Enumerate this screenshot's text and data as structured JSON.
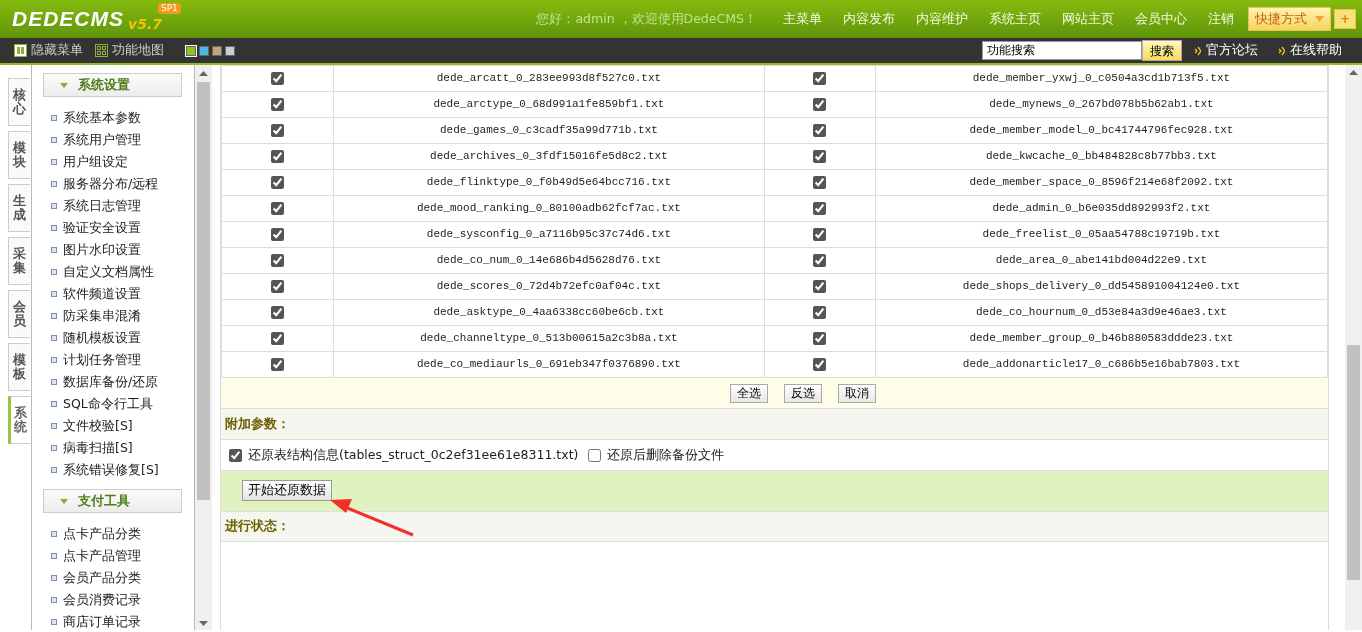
{
  "header": {
    "logo": "DEDECMS",
    "edition": "SP1",
    "version": "v5.7",
    "greeting": "您好：admin ，欢迎使用DedeCMS！",
    "nav": [
      "主菜单",
      "内容发布",
      "内容维护",
      "系统主页",
      "网站主页",
      "会员中心",
      "注销"
    ],
    "shortcut": "快捷方式",
    "add": "+"
  },
  "toolbar": {
    "tools": [
      {
        "label": "隐藏菜单",
        "kind": "hide"
      },
      {
        "label": "功能地图",
        "kind": "map"
      }
    ],
    "skins": [
      {
        "color": "#8dc21f",
        "selected": true
      },
      {
        "color": "#4fb4e6",
        "selected": false
      },
      {
        "color": "#c2a57f",
        "selected": false
      },
      {
        "color": "#c9ccd1",
        "selected": false
      }
    ],
    "search": {
      "value": "功能搜索",
      "button": "搜索"
    },
    "links": [
      "官方论坛",
      "在线帮助"
    ]
  },
  "side_tabs": [
    {
      "label": "核心",
      "selected": false
    },
    {
      "label": "模块",
      "selected": false
    },
    {
      "label": "生成",
      "selected": false
    },
    {
      "label": "采集",
      "selected": false
    },
    {
      "label": "会员",
      "selected": false
    },
    {
      "label": "模板",
      "selected": false
    },
    {
      "label": "系统",
      "selected": true
    }
  ],
  "sidebar": {
    "groups": [
      {
        "title": "系统设置",
        "expanded": true,
        "items": [
          "系统基本参数",
          "系统用户管理",
          "用户组设定",
          "服务器分布/远程",
          "系统日志管理",
          "验证安全设置",
          "图片水印设置",
          "自定义文档属性",
          "软件频道设置",
          "防采集串混淆",
          "随机模板设置",
          "计划任务管理",
          "数据库备份/还原",
          "SQL命令行工具",
          "文件校验[S]",
          "病毒扫描[S]",
          "系统错误修复[S]"
        ]
      },
      {
        "title": "支付工具",
        "expanded": true,
        "items": [
          "点卡产品分类",
          "点卡产品管理",
          "会员产品分类",
          "会员消费记录",
          "商店订单记录"
        ]
      }
    ]
  },
  "table": {
    "rows": [
      {
        "left": {
          "checked": true,
          "file": "dede_arcatt_0_283ee993d8f527c0.txt"
        },
        "right": {
          "checked": true,
          "file": "dede_member_yxwj_0_c0504a3cd1b713f5.txt"
        }
      },
      {
        "left": {
          "checked": true,
          "file": "dede_arctype_0_68d991a1fe859bf1.txt"
        },
        "right": {
          "checked": true,
          "file": "dede_mynews_0_267bd078b5b62ab1.txt"
        }
      },
      {
        "left": {
          "checked": true,
          "file": "dede_games_0_c3cadf35a99d771b.txt"
        },
        "right": {
          "checked": true,
          "file": "dede_member_model_0_bc41744796fec928.txt"
        }
      },
      {
        "left": {
          "checked": true,
          "file": "dede_archives_0_3fdf15016fe5d8c2.txt"
        },
        "right": {
          "checked": true,
          "file": "dede_kwcache_0_bb484828c8b77bb3.txt"
        }
      },
      {
        "left": {
          "checked": true,
          "file": "dede_flinktype_0_f0b49d5e64bcc716.txt"
        },
        "right": {
          "checked": true,
          "file": "dede_member_space_0_8596f214e68f2092.txt"
        }
      },
      {
        "left": {
          "checked": true,
          "file": "dede_mood_ranking_0_80100adb62fcf7ac.txt"
        },
        "right": {
          "checked": true,
          "file": "dede_admin_0_b6e035dd892993f2.txt"
        }
      },
      {
        "left": {
          "checked": true,
          "file": "dede_sysconfig_0_a7116b95c37c74d6.txt"
        },
        "right": {
          "checked": true,
          "file": "dede_freelist_0_05aa54788c19719b.txt"
        }
      },
      {
        "left": {
          "checked": true,
          "file": "dede_co_num_0_14e686b4d5628d76.txt"
        },
        "right": {
          "checked": true,
          "file": "dede_area_0_abe141bd004d22e9.txt"
        }
      },
      {
        "left": {
          "checked": true,
          "file": "dede_scores_0_72d4b72efc0af04c.txt"
        },
        "right": {
          "checked": true,
          "file": "dede_shops_delivery_0_dd545891004124e0.txt"
        }
      },
      {
        "left": {
          "checked": true,
          "file": "dede_asktype_0_4aa6338cc60be6cb.txt"
        },
        "right": {
          "checked": true,
          "file": "dede_co_hournum_0_d53e84a3d9e46ae3.txt"
        }
      },
      {
        "left": {
          "checked": true,
          "file": "dede_channeltype_0_513b00615a2c3b8a.txt"
        },
        "right": {
          "checked": true,
          "file": "dede_member_group_0_b46b880583ddde23.txt"
        }
      },
      {
        "left": {
          "checked": true,
          "file": "dede_co_mediaurls_0_691eb347f0376890.txt"
        },
        "right": {
          "checked": true,
          "file": "dede_addonarticle17_0_c686b5e16bab7803.txt"
        }
      }
    ]
  },
  "actions": [
    "全选",
    "反选",
    "取消"
  ],
  "extra": {
    "title": "附加参数：",
    "options": [
      {
        "label": "还原表结构信息(tables_struct_0c2ef31ee61e8311.txt)",
        "checked": true
      },
      {
        "label": "还原后删除备份文件",
        "checked": false
      }
    ]
  },
  "start_button": "开始还原数据",
  "status": {
    "title": "进行状态："
  }
}
